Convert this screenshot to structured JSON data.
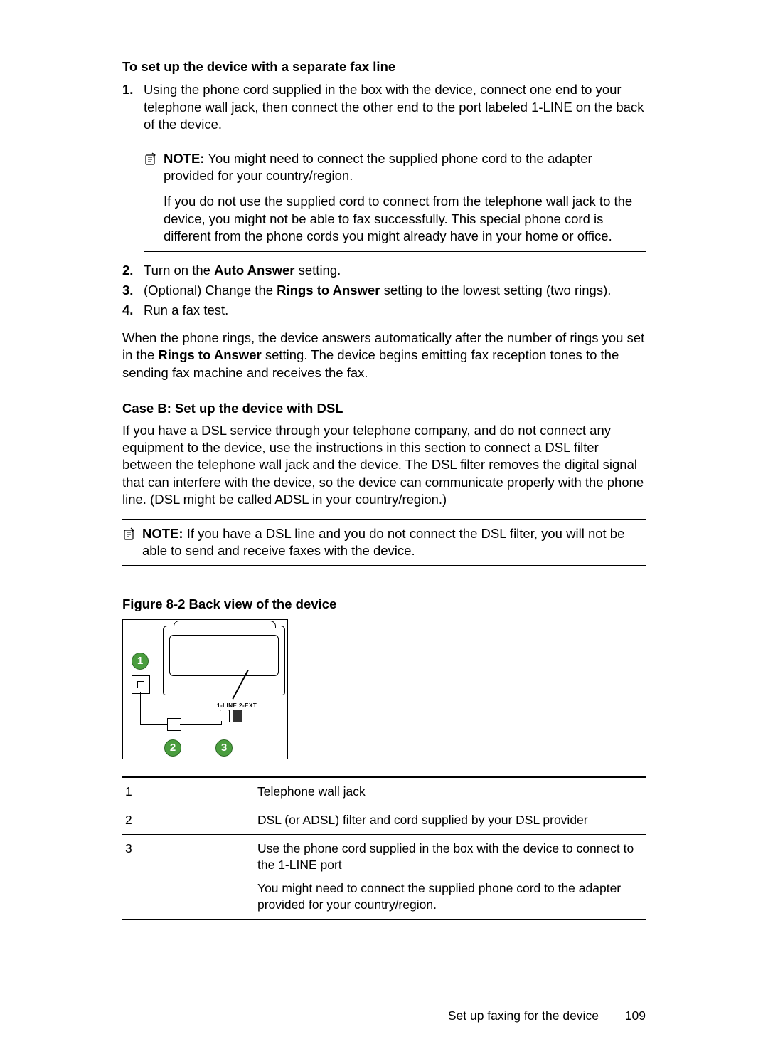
{
  "sectionA": {
    "title": "To set up the device with a separate fax line",
    "steps": {
      "s1": {
        "num": "1.",
        "text": "Using the phone cord supplied in the box with the device, connect one end to your telephone wall jack, then connect the other end to the port labeled 1-LINE on the back of the device."
      },
      "s2": {
        "num": "2.",
        "pre": "Turn on the ",
        "bold": "Auto Answer",
        "post": " setting."
      },
      "s3": {
        "num": "3.",
        "pre": "(Optional) Change the ",
        "bold": "Rings to Answer",
        "post": " setting to the lowest setting (two rings)."
      },
      "s4": {
        "num": "4.",
        "text": "Run a fax test."
      }
    },
    "note": {
      "label": "NOTE:",
      "p1_post": "  You might need to connect the supplied phone cord to the adapter provided for your country/region.",
      "p2": "If you do not use the supplied cord to connect from the telephone wall jack to the device, you might not be able to fax successfully. This special phone cord is different from the phone cords you might already have in your home or office."
    },
    "closing": {
      "pre": "When the phone rings, the device answers automatically after the number of rings you set in the ",
      "bold": "Rings to Answer",
      "post": " setting. The device begins emitting fax reception tones to the sending fax machine and receives the fax."
    }
  },
  "sectionB": {
    "title": "Case B: Set up the device with DSL",
    "para": "If you have a DSL service through your telephone company, and do not connect any equipment to the device, use the instructions in this section to connect a DSL filter between the telephone wall jack and the device. The DSL filter removes the digital signal that can interfere with the device, so the device can communicate properly with the phone line. (DSL might be called ADSL in your country/region.)",
    "note": {
      "label": "NOTE:",
      "text": "  If you have a DSL line and you do not connect the DSL filter, you will not be able to send and receive faxes with the device."
    }
  },
  "figure": {
    "caption": "Figure 8-2 Back view of the device",
    "portLabel": "1-LINE   2-EXT",
    "callouts": {
      "c1": "1",
      "c2": "2",
      "c3": "3"
    }
  },
  "legend": {
    "r1": {
      "num": "1",
      "desc": "Telephone wall jack"
    },
    "r2": {
      "num": "2",
      "desc": "DSL (or ADSL) filter and cord supplied by your DSL provider"
    },
    "r3": {
      "num": "3",
      "p1": "Use the phone cord supplied in the box with the device to connect to the 1-LINE port",
      "p2": "You might need to connect the supplied phone cord to the adapter provided for your country/region."
    }
  },
  "footer": {
    "section": "Set up faxing for the device",
    "page": "109"
  }
}
